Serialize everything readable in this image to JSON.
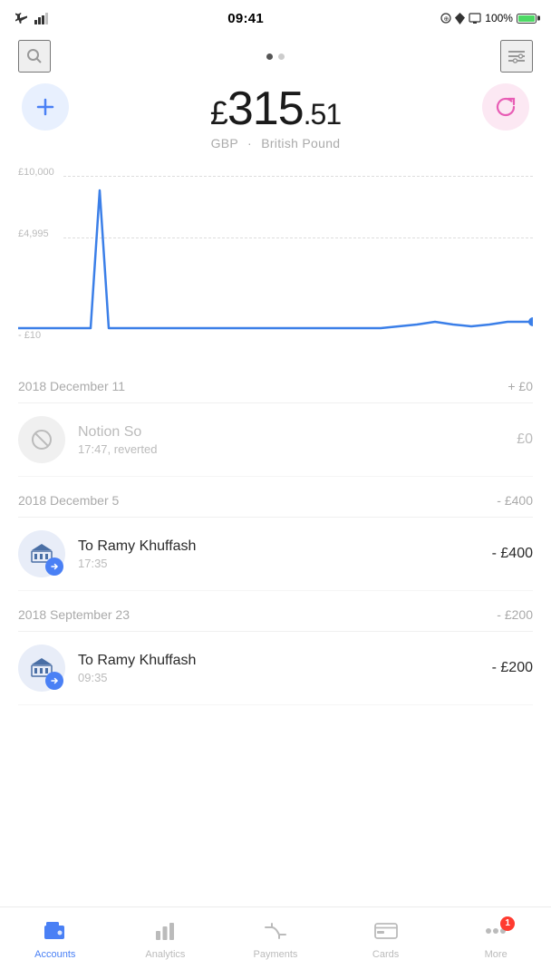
{
  "statusBar": {
    "time": "09:41",
    "batteryPercent": "100%"
  },
  "header": {
    "pageIndicator": [
      true,
      false
    ],
    "balance": {
      "currencySymbol": "£",
      "whole": "315",
      "cents": ".51",
      "currencyCode": "GBP",
      "currencyName": "British Pound"
    },
    "addLabel": "+",
    "refreshLabel": "↻"
  },
  "chart": {
    "labels": {
      "top": "£10,000",
      "mid": "£4,995",
      "bottom": "- £10"
    }
  },
  "transactions": [
    {
      "date": "2018 December 11",
      "amount": "+ £0",
      "items": [
        {
          "id": "notion-so",
          "name": "Notion So",
          "time": "17:47, reverted",
          "amount": "£0",
          "type": "reverted"
        }
      ]
    },
    {
      "date": "2018 December 5",
      "amount": "- £400",
      "items": [
        {
          "id": "ramy-dec",
          "name": "To Ramy Khuffash",
          "time": "17:35",
          "amount": "- £400",
          "type": "transfer"
        }
      ]
    },
    {
      "date": "2018 September 23",
      "amount": "- £200",
      "items": [
        {
          "id": "ramy-sep",
          "name": "To Ramy Khuffash",
          "time": "09:35",
          "amount": "- £200",
          "type": "transfer"
        }
      ]
    }
  ],
  "bottomNav": {
    "items": [
      {
        "id": "accounts",
        "label": "Accounts",
        "icon": "wallet",
        "active": true
      },
      {
        "id": "analytics",
        "label": "Analytics",
        "icon": "chart",
        "active": false
      },
      {
        "id": "payments",
        "label": "Payments",
        "icon": "arrows",
        "active": false
      },
      {
        "id": "cards",
        "label": "Cards",
        "icon": "card",
        "active": false
      },
      {
        "id": "more",
        "label": "More",
        "icon": "dots",
        "active": false,
        "badge": "1"
      }
    ]
  }
}
